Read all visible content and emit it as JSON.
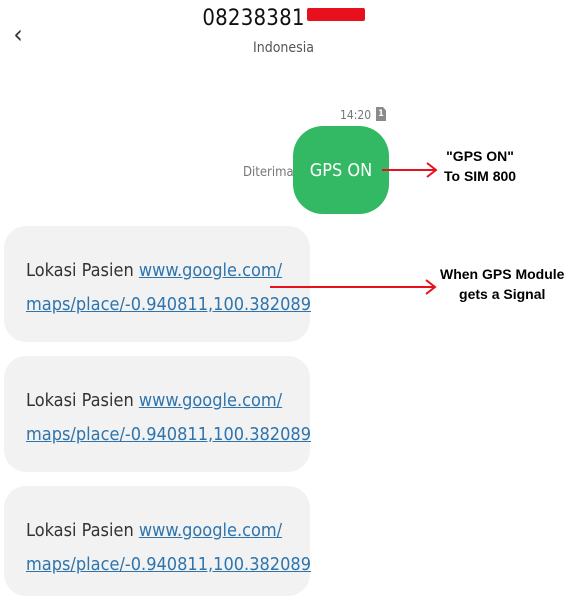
{
  "header": {
    "back_icon": "chevron-left-icon",
    "phone_number": "08238381",
    "country": "Indonesia"
  },
  "sent": {
    "time": "14:20",
    "sim_slot": "1",
    "status": "Diterima",
    "text": "GPS ON"
  },
  "messages": [
    {
      "prefix": "Lokasi Pasien ",
      "link_line1": "www.google.com/",
      "link_line2": "maps/place/-0.940811,100.382089"
    },
    {
      "prefix": "Lokasi Pasien ",
      "link_line1": "www.google.com/",
      "link_line2": "maps/place/-0.940811,100.382089"
    },
    {
      "prefix": "Lokasi Pasien ",
      "link_line1": "www.google.com/",
      "link_line2": "maps/place/-0.940811,100.382089"
    }
  ],
  "annotations": {
    "gps_on_line1": "\"GPS ON\"",
    "gps_on_line2": "To SIM 800",
    "signal_line1": "When GPS Module",
    "signal_line2": "gets a Signal"
  },
  "colors": {
    "sent_bubble": "#33b864",
    "received_bubble": "#f2f2f2",
    "link": "#2e74ad",
    "redaction": "#e8101c",
    "arrow": "#e8101c"
  }
}
